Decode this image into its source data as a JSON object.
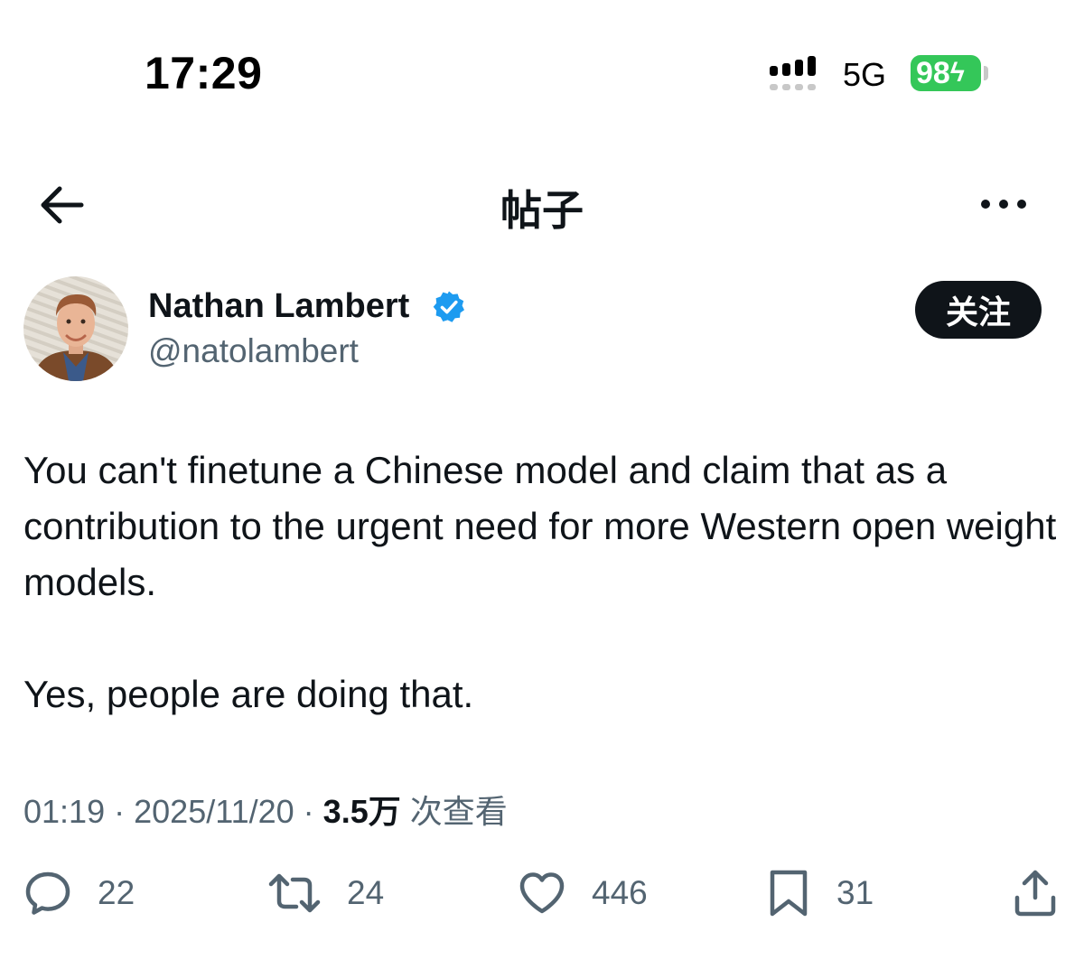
{
  "status_bar": {
    "time": "17:29",
    "network": "5G",
    "battery": "98",
    "battery_color": "#34c759",
    "icons": [
      "signal-icon",
      "battery-charging-icon"
    ]
  },
  "header": {
    "title": "帖子",
    "icons": [
      "back-arrow-icon",
      "more-icon"
    ]
  },
  "author": {
    "display_name": "Nathan Lambert",
    "handle": "@natolambert",
    "verified_color": "#1d9bf0",
    "follow_label": "关注"
  },
  "tweet": {
    "paragraphs": [
      "You can't finetune a Chinese model and claim that as a contribution to the urgent need for more Western open weight models.",
      "Yes, people are doing that."
    ]
  },
  "meta": {
    "time": "01:19",
    "separator": "·",
    "date": "2025/11/20",
    "views_count": "3.5万",
    "views_label": "次查看"
  },
  "actions": {
    "reply_count": "22",
    "retweet_count": "24",
    "like_count": "446",
    "bookmark_count": "31",
    "icons": [
      "reply-icon",
      "retweet-icon",
      "like-icon",
      "bookmark-icon",
      "share-icon"
    ]
  },
  "colors": {
    "text_primary": "#0f1419",
    "text_secondary": "#536471",
    "follow_button_bg": "#0f1419"
  }
}
